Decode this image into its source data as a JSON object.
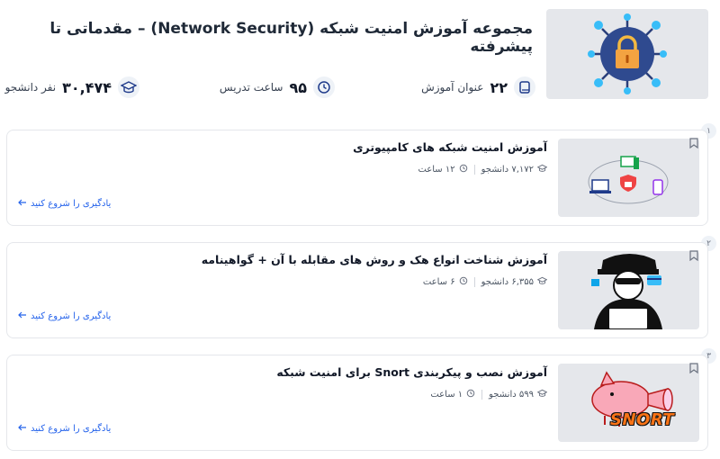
{
  "header": {
    "title": "مجموعه آموزش امنیت شبکه (Network Security) – مقدماتی تا پیشرفته",
    "stats": {
      "topics": {
        "value": "۲۲",
        "label": "عنوان آموزش"
      },
      "hours": {
        "value": "۹۵",
        "label": "ساعت تدریس"
      },
      "students": {
        "value": "۳۰,۴۷۴",
        "label": "نفر دانشجو"
      }
    }
  },
  "courses": [
    {
      "index": "۱",
      "title": "آموزش امنیت شبکه های کامپیوتری",
      "students": "۷,۱۷۲ دانشجو",
      "hours": "۱۲ ساعت",
      "cta": "یادگیری را شروع کنید"
    },
    {
      "index": "۲",
      "title": "آموزش شناخت انواع هک و روش های مقابله با آن + گواهینامه",
      "students": "۶,۳۵۵ دانشجو",
      "hours": "۶ ساعت",
      "cta": "یادگیری را شروع کنید"
    },
    {
      "index": "۳",
      "title": "آموزش نصب و پیکربندی Snort برای امنیت شبکه",
      "students": "۵۹۹ دانشجو",
      "hours": "۱ ساعت",
      "cta": "یادگیری را شروع کنید",
      "thumb_logo": "SNORT"
    }
  ],
  "colors": {
    "accent": "#2563eb",
    "card_border": "#e5e7eb",
    "icon_bg": "#eef2f7",
    "hero_bg": "#e5e7eb"
  }
}
